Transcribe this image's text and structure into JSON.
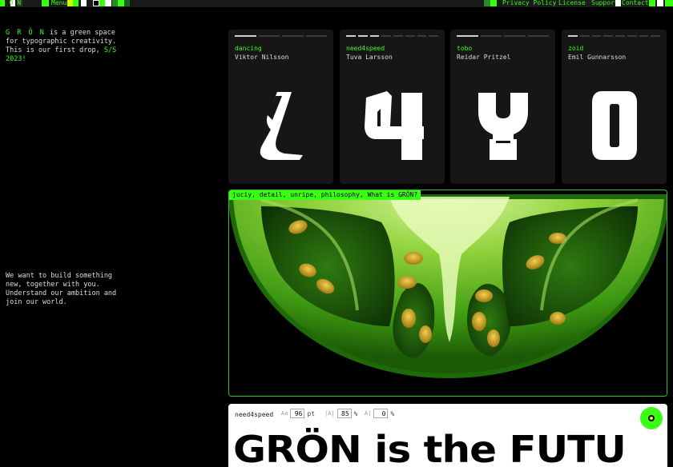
{
  "topbar": {
    "logo": "G  Ö  N",
    "menu_label": "Menu",
    "links": [
      "Privacy Policy",
      "License",
      "Support",
      "Contact"
    ],
    "accent": "#39ff14"
  },
  "intro": {
    "brand": "G R Ö N",
    "text": " is a green space for typographic creativity. This is our first drop, ",
    "drop": "S/S 2023!"
  },
  "invite": {
    "text": "We want to build something new, together with you. Understand our ambition and join our world."
  },
  "cards": [
    {
      "tag": "dancing",
      "author": "Viktor Nilsson",
      "glyph": "ℒ",
      "bars_total": 4,
      "bars_on": 1
    },
    {
      "tag": "need4speed",
      "author": "Tuva Larsson",
      "glyph": "4",
      "bars_total": 8,
      "bars_on": 3
    },
    {
      "tag": "tobo",
      "author": "Reidar Pritzel",
      "glyph": "Y",
      "bars_total": 4,
      "bars_on": 1
    },
    {
      "tag": "zoid",
      "author": "Emil Gunnarsson",
      "glyph": "0",
      "bars_total": 8,
      "bars_on": 1
    }
  ],
  "hero": {
    "chip": "juciy, detail, unripe, philosophy, What is GRÖN?",
    "image": "green-tomato-cross-section"
  },
  "editor": {
    "font_name": "need4speed",
    "size_value": "96",
    "size_unit": "pt",
    "tracking_value": "85",
    "tracking_unit": "%",
    "leading_value": "0",
    "leading_unit": "%",
    "preview_text": "GRÖN is the FUTU",
    "go_icon": "target-icon"
  }
}
